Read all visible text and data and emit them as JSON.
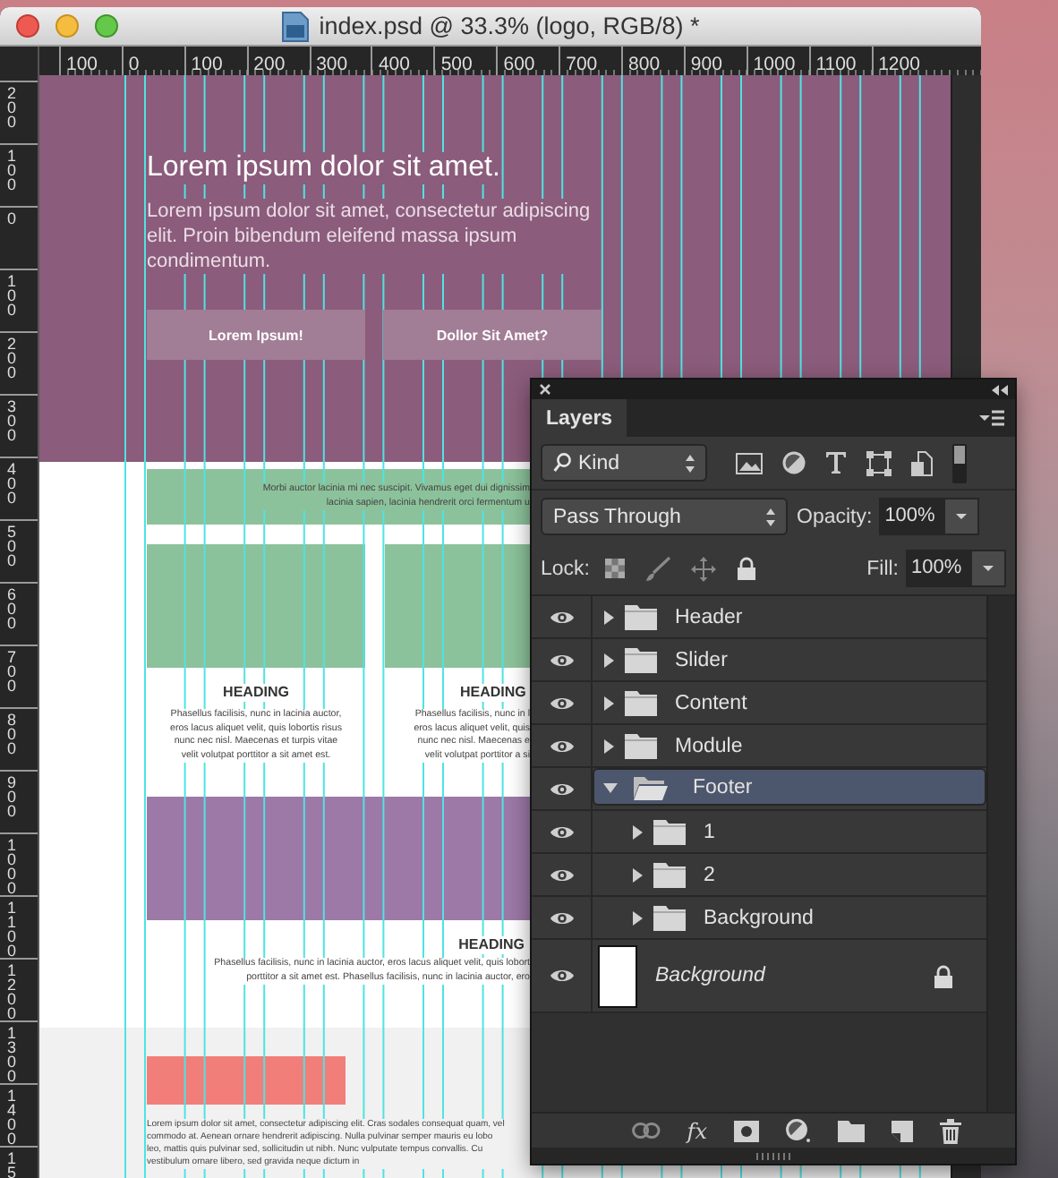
{
  "window": {
    "title": "index.psd @ 33.3% (logo, RGB/8) *"
  },
  "rulers": {
    "horizontal": [
      "100",
      "0",
      "100",
      "200",
      "300",
      "400",
      "500",
      "600",
      "700",
      "800",
      "900",
      "1000",
      "1100",
      "1200"
    ],
    "vertical": [
      "200",
      "100",
      "0",
      "100",
      "200",
      "300",
      "400",
      "500",
      "600",
      "700",
      "800",
      "900",
      "1000",
      "1100",
      "1200",
      "1300",
      "1400",
      "15"
    ]
  },
  "canvas": {
    "hero": {
      "title": "Lorem ipsum dolor sit amet.",
      "text": "Lorem ipsum dolor sit amet, consectetur adipiscing elit. Proin bibendum eleifend massa ipsum condimentum.",
      "buttons": [
        {
          "label": "Lorem Ipsum!"
        },
        {
          "label": "Dollor Sit Amet?"
        }
      ]
    },
    "band": {
      "lines": [
        "Morbi auctor lacinia mi nec suscipit. Vivamus eget dui dignissim",
        "lacinia sapien, lacinia hendrerit orci fermentum u"
      ]
    },
    "columns": [
      {
        "heading": "HEADING",
        "lines": [
          "Phasellus facilisis, nunc in lacinia auctor,",
          "eros lacus aliquet velit, quis lobortis risus",
          "nunc nec nisl. Maecenas et turpis vitae",
          "velit volutpat porttitor a sit amet est."
        ]
      },
      {
        "heading": "HEADING",
        "lines": [
          "Phasellus facilisis, nunc in l",
          "eros lacus aliquet velit, quis",
          "nunc nec nisl. Maecenas e",
          "velit volutpat porttitor a si"
        ]
      }
    ],
    "wide": {
      "heading": "HEADING",
      "lines": [
        "Phasellus facilisis, nunc in lacinia auctor, eros lacus aliquet velit, quis lobort",
        "porttitor a sit amet est. Phasellus facilisis, nunc in lacinia auctor, ero"
      ]
    },
    "footer": {
      "lines": [
        "Lorem ipsum dolor sit amet, consectetur adipiscing elit. Cras sodales consequat quam, vel",
        "commodo at. Aenean ornare hendrerit adipiscing. Nulla pulvinar semper mauris eu lobo",
        "leo, mattis quis pulvinar sed, sollicitudin ut nibh. Nunc vulputate tempus convallis. Cu",
        "vestibulum ornare libero, sed gravida neque dictum in"
      ]
    }
  },
  "layers_panel": {
    "tab": {
      "label": "Layers",
      "selected": true
    },
    "filter": {
      "value": "Kind"
    },
    "blend_mode": {
      "value": "Pass Through"
    },
    "opacity": {
      "label": "Opacity:",
      "value": "100%"
    },
    "lock_label": "Lock:",
    "fill": {
      "label": "Fill:",
      "value": "100%"
    },
    "layers": [
      {
        "name": "Header",
        "kind": "group",
        "visible": true,
        "expanded": false,
        "selected": false
      },
      {
        "name": "Slider",
        "kind": "group",
        "visible": true,
        "expanded": false,
        "selected": false
      },
      {
        "name": "Content",
        "kind": "group",
        "visible": true,
        "expanded": false,
        "selected": false
      },
      {
        "name": "Module",
        "kind": "group",
        "visible": true,
        "expanded": false,
        "selected": false
      },
      {
        "name": "Footer",
        "kind": "group",
        "visible": true,
        "expanded": true,
        "selected": true,
        "children": [
          {
            "name": "1",
            "kind": "group",
            "visible": true,
            "expanded": false,
            "selected": false
          },
          {
            "name": "2",
            "kind": "group",
            "visible": true,
            "expanded": false,
            "selected": false
          },
          {
            "name": "Background",
            "kind": "group",
            "visible": true,
            "expanded": false,
            "selected": false
          }
        ]
      },
      {
        "name": "Background",
        "kind": "image",
        "visible": true,
        "locked": true,
        "selected": false
      }
    ],
    "fx_button": {
      "label": "fx"
    }
  }
}
